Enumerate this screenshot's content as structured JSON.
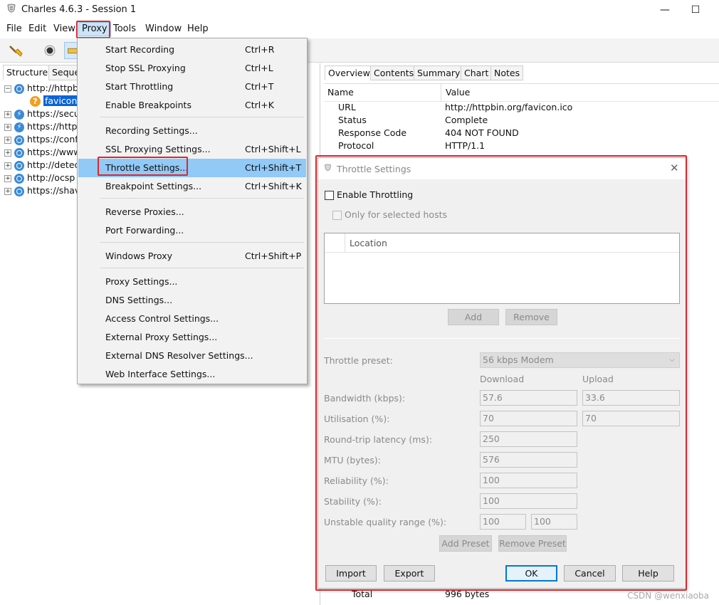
{
  "window": {
    "title": "Charles 4.6.3 - Session 1",
    "minimize_glyph": "—",
    "maximize_glyph": "☐"
  },
  "menubar": {
    "items": [
      "File",
      "Edit",
      "View",
      "Proxy",
      "Tools",
      "Window",
      "Help"
    ],
    "active": "Proxy"
  },
  "left_panel": {
    "tabs": [
      "Structure",
      "Seque"
    ],
    "tree": [
      {
        "expanded": true,
        "icon": "globe-icon",
        "text": "http://httpb"
      },
      {
        "child": true,
        "icon": "question-icon",
        "text": "favicon.i",
        "selected": true
      },
      {
        "icon": "bolt-icon",
        "text": "https://secu"
      },
      {
        "icon": "bolt-icon",
        "text": "https://http"
      },
      {
        "icon": "globe-icon",
        "text": "https://conf"
      },
      {
        "icon": "globe-icon",
        "text": "https://www"
      },
      {
        "icon": "globe-icon",
        "text": "http://detec"
      },
      {
        "icon": "globe-icon",
        "text": "http://ocsp"
      },
      {
        "icon": "globe-icon",
        "text": "https://shav"
      }
    ]
  },
  "right_panel": {
    "tabs": [
      "Overview",
      "Contents",
      "Summary",
      "Chart",
      "Notes"
    ],
    "columns": {
      "name": "Name",
      "value": "Value"
    },
    "rows": [
      {
        "name": "URL",
        "value": "http://httpbin.org/favicon.ico"
      },
      {
        "name": "Status",
        "value": "Complete"
      },
      {
        "name": "Response Code",
        "value": "404 NOT FOUND"
      },
      {
        "name": "Protocol",
        "value": "HTTP/1.1"
      }
    ],
    "footer_row": {
      "name": "Total",
      "value": "996 bytes"
    }
  },
  "proxy_menu": {
    "groups": [
      [
        {
          "label": "Start Recording",
          "shortcut": "Ctrl+R"
        },
        {
          "label": "Stop SSL Proxying",
          "shortcut": "Ctrl+L"
        },
        {
          "label": "Start Throttling",
          "shortcut": "Ctrl+T"
        },
        {
          "label": "Enable Breakpoints",
          "shortcut": "Ctrl+K"
        }
      ],
      [
        {
          "label": "Recording Settings...",
          "shortcut": ""
        },
        {
          "label": "SSL Proxying Settings...",
          "shortcut": "Ctrl+Shift+L"
        },
        {
          "label": "Throttle Settings...",
          "shortcut": "Ctrl+Shift+T",
          "highlighted": true
        },
        {
          "label": "Breakpoint Settings...",
          "shortcut": "Ctrl+Shift+K"
        }
      ],
      [
        {
          "label": "Reverse Proxies...",
          "shortcut": ""
        },
        {
          "label": "Port Forwarding...",
          "shortcut": ""
        }
      ],
      [
        {
          "label": "Windows Proxy",
          "shortcut": "Ctrl+Shift+P"
        }
      ],
      [
        {
          "label": "Proxy Settings...",
          "shortcut": ""
        },
        {
          "label": "DNS Settings...",
          "shortcut": ""
        },
        {
          "label": "Access Control Settings...",
          "shortcut": ""
        },
        {
          "label": "External Proxy Settings...",
          "shortcut": ""
        },
        {
          "label": "External DNS Resolver Settings...",
          "shortcut": ""
        },
        {
          "label": "Web Interface Settings...",
          "shortcut": ""
        }
      ]
    ]
  },
  "throttle_dialog": {
    "title": "Throttle Settings",
    "close_glyph": "✕",
    "enable_throttling": {
      "label": "Enable Throttling",
      "checked": false
    },
    "only_selected_hosts": {
      "label": "Only for selected hosts",
      "checked": false
    },
    "hosts_table": {
      "column": "Location"
    },
    "add_label": "Add",
    "remove_label": "Remove",
    "preset": {
      "label": "Throttle preset:",
      "value": "56 kbps Modem"
    },
    "col_download": "Download",
    "col_upload": "Upload",
    "bandwidth": {
      "label": "Bandwidth (kbps):",
      "download": "57.6",
      "upload": "33.6"
    },
    "utilisation": {
      "label": "Utilisation (%):",
      "download": "70",
      "upload": "70"
    },
    "latency": {
      "label": "Round-trip latency (ms):",
      "value": "250"
    },
    "mtu": {
      "label": "MTU (bytes):",
      "value": "576"
    },
    "reliability": {
      "label": "Reliability (%):",
      "value": "100"
    },
    "stability": {
      "label": "Stability (%):",
      "value": "100"
    },
    "unstable_range": {
      "label": "Unstable quality range (%):",
      "low": "100",
      "high": "100"
    },
    "add_preset_label": "Add Preset",
    "remove_preset_label": "Remove Preset",
    "import_label": "Import",
    "export_label": "Export",
    "ok_label": "OK",
    "cancel_label": "Cancel",
    "help_label": "Help"
  },
  "watermark": "CSDN @wenxiaoba",
  "colors": {
    "highlight_box": "#e0262b",
    "menu_highlight": "#91c9f7",
    "selection": "#0a64d8"
  }
}
